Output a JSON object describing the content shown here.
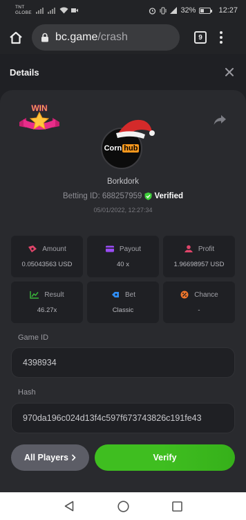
{
  "status_bar": {
    "carrier_line1": "TNT",
    "carrier_line2": "GLOBE",
    "battery_percent": "32%",
    "battery_level": 0.32,
    "time": "12:27"
  },
  "browser": {
    "url_host": "bc.game",
    "url_path": "/crash",
    "tab_count": "9"
  },
  "header": {
    "title": "Details"
  },
  "profile": {
    "badge_text": "WIN",
    "avatar_text_1": "Corn",
    "avatar_text_2": "hub",
    "username": "Borkdork",
    "betting_id_label": "Betting ID: 688257959",
    "verified_label": "Verified",
    "timestamp": "05/01/2022, 12:27:34"
  },
  "stats": [
    {
      "label": "Amount",
      "value": "0.05043563 USD",
      "icon": "amount-icon",
      "color": "#e0456a"
    },
    {
      "label": "Payout",
      "value": "40 x",
      "icon": "payout-icon",
      "color": "#9a4cf5"
    },
    {
      "label": "Profit",
      "value": "1.96698957 USD",
      "icon": "profit-icon",
      "color": "#e0456a"
    },
    {
      "label": "Result",
      "value": "46.27x",
      "icon": "result-icon",
      "color": "#38b43a"
    },
    {
      "label": "Bet",
      "value": "Classic",
      "icon": "bet-icon",
      "color": "#2f8df5"
    },
    {
      "label": "Chance",
      "value": "-",
      "icon": "chance-icon",
      "color": "#f0762b"
    }
  ],
  "game_id": {
    "label": "Game ID",
    "value": "4398934"
  },
  "hash": {
    "label": "Hash",
    "value": "970da196c024d13f4c597f673743826c191fe43"
  },
  "actions": {
    "all_players_label": "All Players",
    "verify_label": "Verify"
  },
  "colors": {
    "background": "#1f2024",
    "panel": "#292a2e",
    "verify_green": "#3fbe20",
    "verified_green": "#3fcf3a"
  }
}
